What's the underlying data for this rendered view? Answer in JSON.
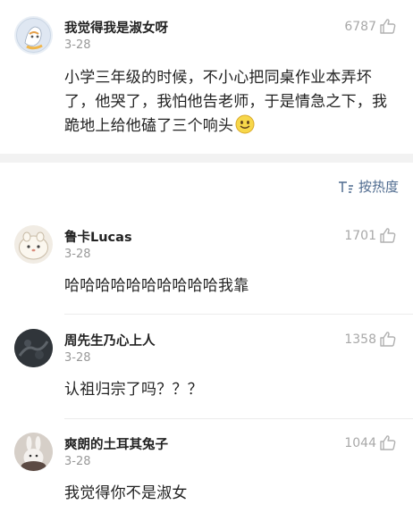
{
  "main_post": {
    "username": "我觉得我是淑女呀",
    "date": "3-28",
    "likes": "6787",
    "text": "小学三年级的时候，不小心把同桌作业本弄坏了，他哭了，我怕他告老师，于是情急之下，我跪地上给他磕了三个响头",
    "emoji_icon": "smile-emoji-icon"
  },
  "sort": {
    "label": "按热度"
  },
  "replies": [
    {
      "username": "鲁卡Lucas",
      "date": "3-28",
      "likes": "1701",
      "text": "哈哈哈哈哈哈哈哈哈哈我靠"
    },
    {
      "username": "周先生乃心上人",
      "date": "3-28",
      "likes": "1358",
      "text": "认祖归宗了吗？？？"
    },
    {
      "username": "爽朗的土耳其兔子",
      "date": "3-28",
      "likes": "1044",
      "text": "我觉得你不是淑女"
    }
  ],
  "colors": {
    "link": "#4f6b8f",
    "meta": "#999999",
    "separator": "#f2f2f2"
  }
}
